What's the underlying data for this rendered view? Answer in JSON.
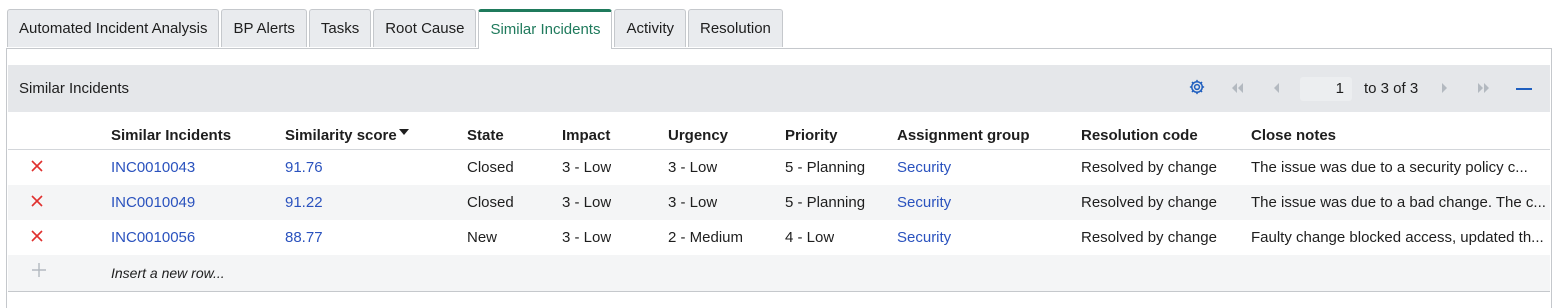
{
  "tabs": [
    {
      "label": "Automated Incident Analysis",
      "active": false
    },
    {
      "label": "BP Alerts",
      "active": false
    },
    {
      "label": "Tasks",
      "active": false
    },
    {
      "label": "Root Cause",
      "active": false
    },
    {
      "label": "Similar Incidents",
      "active": true
    },
    {
      "label": "Activity",
      "active": false
    },
    {
      "label": "Resolution",
      "active": false
    }
  ],
  "list": {
    "title": "Similar Incidents",
    "pagination": {
      "current": "1",
      "range_text": "to 3 of 3"
    },
    "columns": [
      "Similar Incidents",
      "Similarity score",
      "State",
      "Impact",
      "Urgency",
      "Priority",
      "Assignment group",
      "Resolution code",
      "Close notes"
    ],
    "sorted_column": "Similarity score",
    "sort_direction": "descending",
    "rows": [
      {
        "number": "INC0010043",
        "score": "91.76",
        "state": "Closed",
        "impact": "3 - Low",
        "urgency": "3 - Low",
        "priority": "5 - Planning",
        "group": "Security",
        "resolution_code": "Resolved by change",
        "close_notes": "The issue was due to a security policy c..."
      },
      {
        "number": "INC0010049",
        "score": "91.22",
        "state": "Closed",
        "impact": "3 - Low",
        "urgency": "3 - Low",
        "priority": "5 - Planning",
        "group": "Security",
        "resolution_code": "Resolved by change",
        "close_notes": "The issue was due to a bad change. The c..."
      },
      {
        "number": "INC0010056",
        "score": "88.77",
        "state": "New",
        "impact": "3 - Low",
        "urgency": "2 - Medium",
        "priority": "4 - Low",
        "group": "Security",
        "resolution_code": "Resolved by change",
        "close_notes": "Faulty change blocked access, updated th..."
      }
    ],
    "insert_row_label": "Insert a new row..."
  },
  "icons": {
    "settings": "gear-icon",
    "first_page": "double-chevron-left-icon",
    "prev_page": "chevron-left-icon",
    "next_page": "chevron-right-icon",
    "last_page": "double-chevron-right-icon",
    "collapse": "minus-icon",
    "delete_row": "close-icon",
    "insert_row": "plus-icon"
  },
  "colors": {
    "active_tab": "#1f7a5c",
    "link": "#2a52be",
    "delete": "#e0302e",
    "header_bg": "#e5e7ea",
    "row_alt": "#f4f5f6"
  }
}
